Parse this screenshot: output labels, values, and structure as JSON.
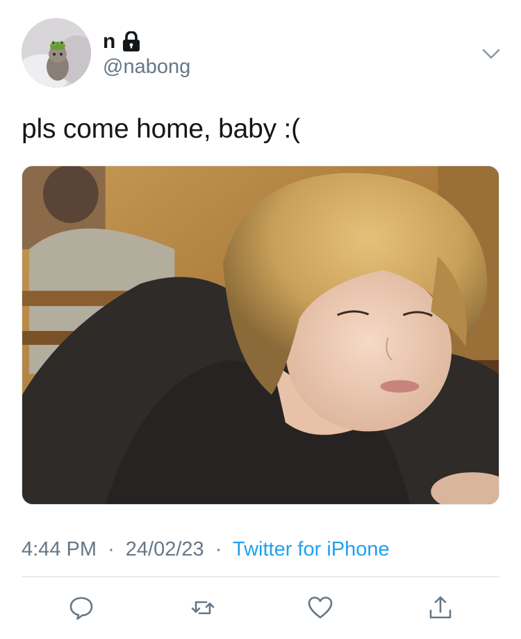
{
  "author": {
    "display_name": "n",
    "handle": "@nabong",
    "protected": true,
    "avatar_icon": "avatar-cat-with-frog-hat",
    "lock_icon": "lock-icon"
  },
  "tweet": {
    "text": "pls come home, baby :(",
    "media_description_icon": "photo",
    "time": "4:44 PM",
    "date": "24/02/23",
    "separator": "·",
    "source": "Twitter for iPhone"
  },
  "actions": {
    "reply_icon": "reply-icon",
    "retweet_icon": "retweet-icon",
    "like_icon": "heart-icon",
    "share_icon": "share-icon"
  },
  "colors": {
    "text": "#14171a",
    "secondary": "#657786",
    "link": "#1da1f2",
    "divider": "#dadfe3"
  }
}
